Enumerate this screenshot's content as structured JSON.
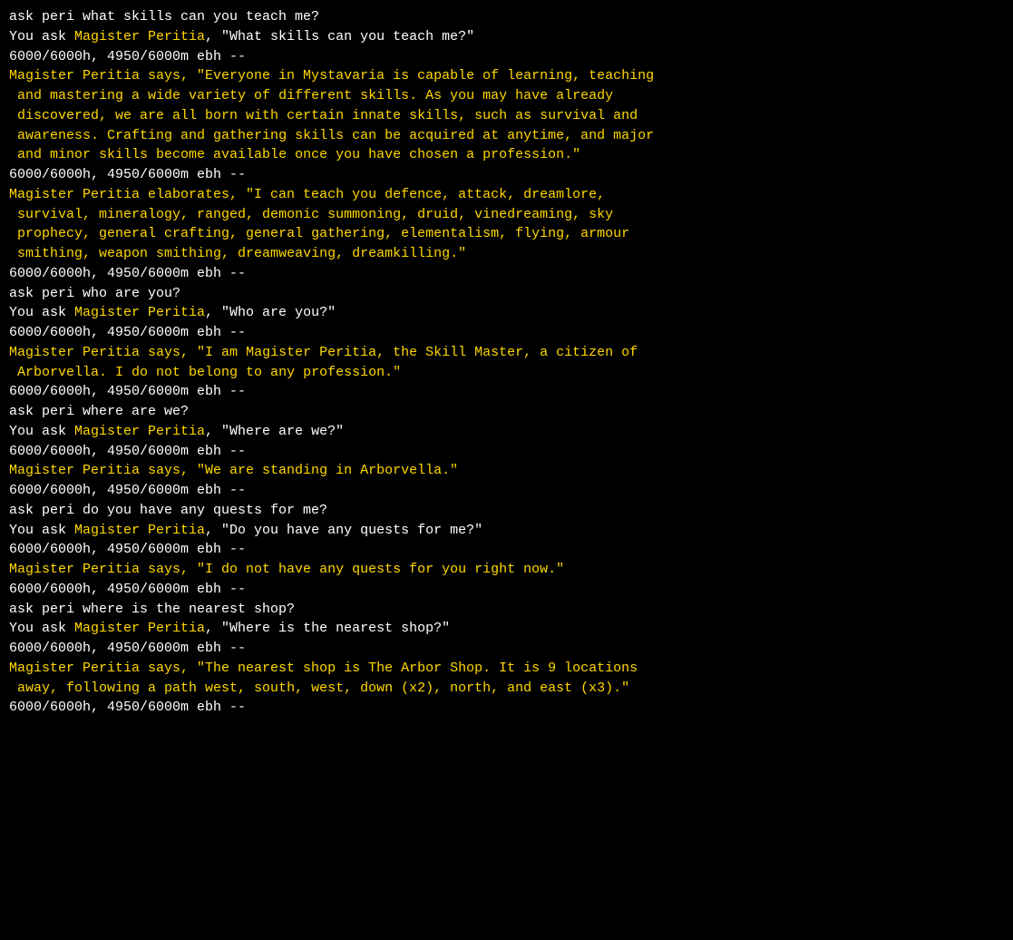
{
  "terminal": {
    "lines": [
      {
        "segments": [
          {
            "text": "ask peri what skills can you teach me?",
            "color": "white"
          }
        ]
      },
      {
        "segments": [
          {
            "text": "You ask ",
            "color": "white"
          },
          {
            "text": "Magister Peritia",
            "color": "yellow"
          },
          {
            "text": ", \"What skills can you teach me?\"",
            "color": "white"
          }
        ]
      },
      {
        "segments": [
          {
            "text": "6000/6000h, 4950/6000m ebh --",
            "color": "white"
          }
        ]
      },
      {
        "segments": [
          {
            "text": "Magister Peritia",
            "color": "yellow"
          },
          {
            "text": " says, \"Everyone in Mystavaria is capable of learning, teaching",
            "color": "yellow"
          }
        ]
      },
      {
        "segments": [
          {
            "text": " and mastering a wide variety of different skills. As you may have already",
            "color": "yellow"
          }
        ]
      },
      {
        "segments": [
          {
            "text": " discovered, we are all born with certain innate skills, such as survival and",
            "color": "yellow"
          }
        ]
      },
      {
        "segments": [
          {
            "text": " awareness. Crafting and gathering skills can be acquired at anytime, and major",
            "color": "yellow"
          }
        ]
      },
      {
        "segments": [
          {
            "text": " and minor skills become available once you have chosen a profession.\"",
            "color": "yellow"
          }
        ]
      },
      {
        "segments": [
          {
            "text": "6000/6000h, 4950/6000m ebh --",
            "color": "white"
          }
        ]
      },
      {
        "segments": [
          {
            "text": "Magister Peritia",
            "color": "yellow"
          },
          {
            "text": " elaborates, \"I can teach you defence, attack, dreamlore,",
            "color": "yellow"
          }
        ]
      },
      {
        "segments": [
          {
            "text": " survival, mineralogy, ranged, demonic summoning, druid, vinedreaming, sky",
            "color": "yellow"
          }
        ]
      },
      {
        "segments": [
          {
            "text": " prophecy, general crafting, general gathering, elementalism, flying, armour",
            "color": "yellow"
          }
        ]
      },
      {
        "segments": [
          {
            "text": " smithing, weapon smithing, dreamweaving, dreamkilling.\"",
            "color": "yellow"
          }
        ]
      },
      {
        "segments": [
          {
            "text": "6000/6000h, 4950/6000m ebh --",
            "color": "white"
          }
        ]
      },
      {
        "segments": [
          {
            "text": "ask peri who are you?",
            "color": "white"
          }
        ]
      },
      {
        "segments": [
          {
            "text": "You ask ",
            "color": "white"
          },
          {
            "text": "Magister Peritia",
            "color": "yellow"
          },
          {
            "text": ", \"Who are you?\"",
            "color": "white"
          }
        ]
      },
      {
        "segments": [
          {
            "text": "6000/6000h, 4950/6000m ebh --",
            "color": "white"
          }
        ]
      },
      {
        "segments": [
          {
            "text": "Magister Peritia",
            "color": "yellow"
          },
          {
            "text": " says, \"I am ",
            "color": "yellow"
          },
          {
            "text": "Magister Peritia, the Skill Master",
            "color": "yellow"
          },
          {
            "text": ", a citizen of",
            "color": "yellow"
          }
        ]
      },
      {
        "segments": [
          {
            "text": " Arborvella. I do not belong to any profession.\"",
            "color": "yellow"
          }
        ]
      },
      {
        "segments": [
          {
            "text": "6000/6000h, 4950/6000m ebh --",
            "color": "white"
          }
        ]
      },
      {
        "segments": [
          {
            "text": "ask peri where are we?",
            "color": "white"
          }
        ]
      },
      {
        "segments": [
          {
            "text": "You ask ",
            "color": "white"
          },
          {
            "text": "Magister Peritia",
            "color": "yellow"
          },
          {
            "text": ", \"Where are we?\"",
            "color": "white"
          }
        ]
      },
      {
        "segments": [
          {
            "text": "6000/6000h, 4950/6000m ebh --",
            "color": "white"
          }
        ]
      },
      {
        "segments": [
          {
            "text": "Magister Peritia",
            "color": "yellow"
          },
          {
            "text": " says, \"We are standing in Arborvella.\"",
            "color": "yellow"
          }
        ]
      },
      {
        "segments": [
          {
            "text": "6000/6000h, 4950/6000m ebh --",
            "color": "white"
          }
        ]
      },
      {
        "segments": [
          {
            "text": "ask peri do you have any quests for me?",
            "color": "white"
          }
        ]
      },
      {
        "segments": [
          {
            "text": "You ask ",
            "color": "white"
          },
          {
            "text": "Magister Peritia",
            "color": "yellow"
          },
          {
            "text": ", \"Do you have any quests for me?\"",
            "color": "white"
          }
        ]
      },
      {
        "segments": [
          {
            "text": "6000/6000h, 4950/6000m ebh --",
            "color": "white"
          }
        ]
      },
      {
        "segments": [
          {
            "text": "Magister Peritia",
            "color": "yellow"
          },
          {
            "text": " says, \"I do not have any quests for you right now.\"",
            "color": "yellow"
          }
        ]
      },
      {
        "segments": [
          {
            "text": "6000/6000h, 4950/6000m ebh --",
            "color": "white"
          }
        ]
      },
      {
        "segments": [
          {
            "text": "ask peri where is the nearest shop?",
            "color": "white"
          }
        ]
      },
      {
        "segments": [
          {
            "text": "You ask ",
            "color": "white"
          },
          {
            "text": "Magister Peritia",
            "color": "yellow"
          },
          {
            "text": ", \"Where is the nearest shop?\"",
            "color": "white"
          }
        ]
      },
      {
        "segments": [
          {
            "text": "6000/6000h, 4950/6000m ebh --",
            "color": "white"
          }
        ]
      },
      {
        "segments": [
          {
            "text": "Magister Peritia",
            "color": "yellow"
          },
          {
            "text": " says, \"The nearest shop is The Arbor Shop. It is 9 locations",
            "color": "yellow"
          }
        ]
      },
      {
        "segments": [
          {
            "text": " away, following a path west, south, west, down (x2), north, and east (x3).\"",
            "color": "yellow"
          }
        ]
      },
      {
        "segments": [
          {
            "text": "6000/6000h, 4950/6000m ebh --",
            "color": "white"
          }
        ]
      }
    ]
  }
}
